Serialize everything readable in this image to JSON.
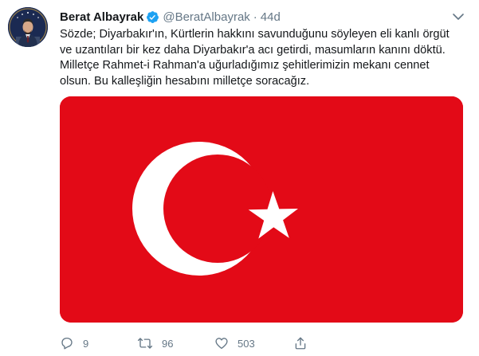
{
  "tweet": {
    "author_name": "Berat Albayrak",
    "handle": "@BeratAlbayrak",
    "separator": "·",
    "time": "44d",
    "verified": true,
    "text_lines": [
      "Sözde; Diyarbakır'ın, Kürtlerin hakkını savunduğunu söyleyen eli kanlı örgüt",
      "ve uzantıları bir kez daha Diyarbakır'a acı getirdi, masumların kanını döktü.",
      "Milletçe Rahmet-i Rahman'a uğurladığımız şehitlerimizin mekanı cennet",
      "olsun. Bu kalleşliğin hesabını milletçe soracağız."
    ],
    "media": {
      "type": "flag",
      "flag_red": "#e30a17",
      "flag_white": "#ffffff"
    },
    "actions": {
      "reply_count": "9",
      "retweet_count": "96",
      "like_count": "503"
    }
  },
  "colors": {
    "text": "#14171a",
    "secondary": "#657786",
    "verified": "#1da1f2"
  },
  "icons": {
    "avatar": "avatar",
    "verified": "verified-badge-icon",
    "more": "chevron-down-icon",
    "reply": "reply-icon",
    "retweet": "retweet-icon",
    "like": "heart-icon",
    "share": "share-icon"
  }
}
